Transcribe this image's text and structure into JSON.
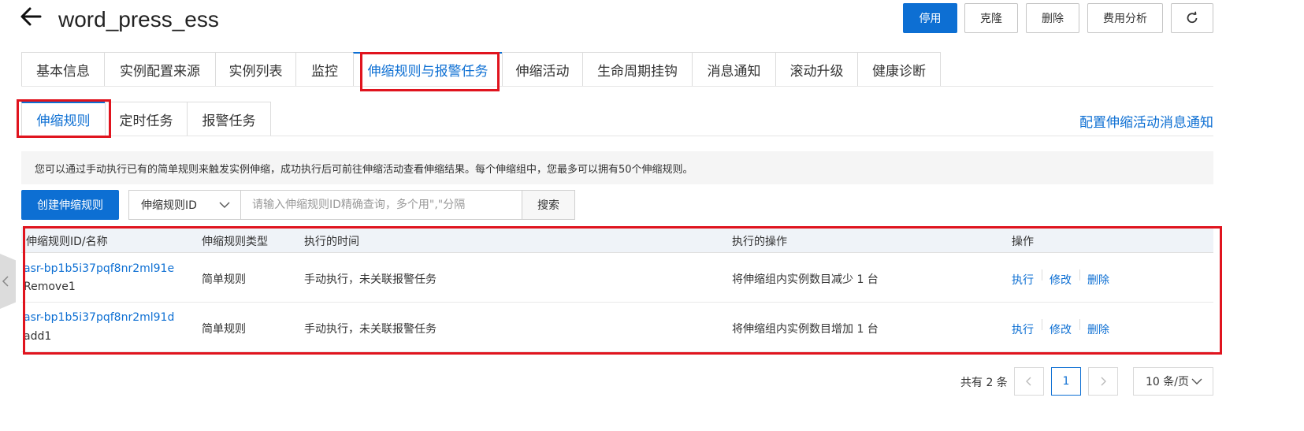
{
  "header": {
    "back_icon": "arrow-left-icon",
    "title": "word_press_ess",
    "buttons": {
      "disable": "停用",
      "clone": "克隆",
      "delete": "删除",
      "cost": "费用分析",
      "refresh_icon": "refresh-icon"
    },
    "primary_color": "#0d6fd3"
  },
  "main_tabs": [
    {
      "label": "基本信息"
    },
    {
      "label": "实例配置来源"
    },
    {
      "label": "实例列表"
    },
    {
      "label": "监控"
    },
    {
      "label": "伸缩规则与报警任务",
      "active": true
    },
    {
      "label": "伸缩活动"
    },
    {
      "label": "生命周期挂钩"
    },
    {
      "label": "消息通知"
    },
    {
      "label": "滚动升级"
    },
    {
      "label": "健康诊断"
    }
  ],
  "sub_tabs": [
    {
      "label": "伸缩规则",
      "active": true
    },
    {
      "label": "定时任务"
    },
    {
      "label": "报警任务"
    }
  ],
  "config_link": "配置伸缩活动消息通知",
  "info_text": "您可以通过手动执行已有的简单规则来触发实例伸缩，成功执行后可前往伸缩活动查看伸缩结果。每个伸缩组中，您最多可以拥有50个伸缩规则。",
  "toolbar": {
    "create_label": "创建伸缩规则",
    "select_value": "伸缩规则ID",
    "search_placeholder": "请输入伸缩规则ID精确查询，多个用\",\"分隔",
    "search_label": "搜索"
  },
  "table": {
    "columns": [
      "伸缩规则ID/名称",
      "伸缩规则类型",
      "执行的时间",
      "执行的操作",
      "操作"
    ],
    "rows": [
      {
        "id": "asr-bp1b5i37pqf8nr2ml91e",
        "name": "Remove1",
        "type": "简单规则",
        "time": "手动执行，未关联报警任务",
        "action": "将伸缩组内实例数目减少 1 台",
        "ops": [
          "执行",
          "修改",
          "删除"
        ]
      },
      {
        "id": "asr-bp1b5i37pqf8nr2ml91d",
        "name": "add1",
        "type": "简单规则",
        "time": "手动执行，未关联报警任务",
        "action": "将伸缩组内实例数目增加 1 台",
        "ops": [
          "执行",
          "修改",
          "删除"
        ]
      }
    ]
  },
  "pagination": {
    "total": "共有 2 条",
    "current_page": "1",
    "page_size": "10 条/页"
  },
  "highlight_color": "#e0141e"
}
